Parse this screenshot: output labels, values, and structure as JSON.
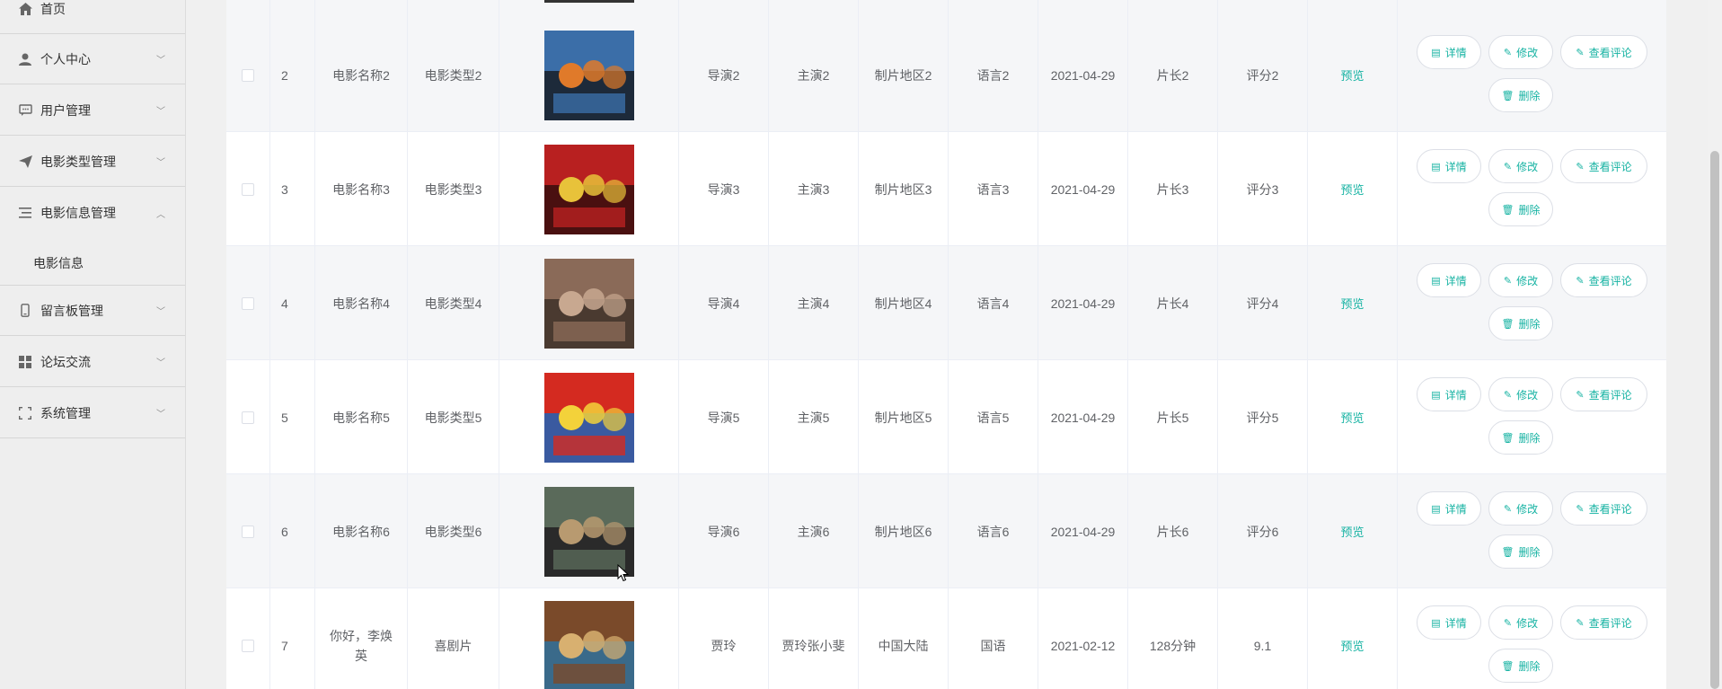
{
  "sidebar": {
    "items": [
      {
        "label": "首页",
        "icon": "home-icon"
      },
      {
        "label": "个人中心",
        "icon": "user-icon"
      },
      {
        "label": "用户管理",
        "icon": "chat-icon"
      },
      {
        "label": "电影类型管理",
        "icon": "send-icon"
      },
      {
        "label": "电影信息管理",
        "icon": "list-icon"
      },
      {
        "label": "留言板管理",
        "icon": "phone-icon"
      },
      {
        "label": "论坛交流",
        "icon": "grid-icon"
      },
      {
        "label": "系统管理",
        "icon": "fullscreen-icon"
      }
    ],
    "submenu": {
      "label": "电影信息"
    }
  },
  "table": {
    "rows": [
      {
        "id": "2",
        "name": "电影名称2",
        "type": "电影类型2",
        "director": "导演2",
        "actor": "主演2",
        "region": "制片地区2",
        "language": "语言2",
        "date": "2021-04-29",
        "duration": "片长2",
        "rating": "评分2",
        "preview": "预览"
      },
      {
        "id": "3",
        "name": "电影名称3",
        "type": "电影类型3",
        "director": "导演3",
        "actor": "主演3",
        "region": "制片地区3",
        "language": "语言3",
        "date": "2021-04-29",
        "duration": "片长3",
        "rating": "评分3",
        "preview": "预览"
      },
      {
        "id": "4",
        "name": "电影名称4",
        "type": "电影类型4",
        "director": "导演4",
        "actor": "主演4",
        "region": "制片地区4",
        "language": "语言4",
        "date": "2021-04-29",
        "duration": "片长4",
        "rating": "评分4",
        "preview": "预览"
      },
      {
        "id": "5",
        "name": "电影名称5",
        "type": "电影类型5",
        "director": "导演5",
        "actor": "主演5",
        "region": "制片地区5",
        "language": "语言5",
        "date": "2021-04-29",
        "duration": "片长5",
        "rating": "评分5",
        "preview": "预览"
      },
      {
        "id": "6",
        "name": "电影名称6",
        "type": "电影类型6",
        "director": "导演6",
        "actor": "主演6",
        "region": "制片地区6",
        "language": "语言6",
        "date": "2021-04-29",
        "duration": "片长6",
        "rating": "评分6",
        "preview": "预览"
      },
      {
        "id": "7",
        "name": "你好，李焕英",
        "type": "喜剧片",
        "director": "贾玲",
        "actor": "贾玲张小斐",
        "region": "中国大陆",
        "language": "国语",
        "date": "2021-02-12",
        "duration": "128分钟",
        "rating": "9.1",
        "preview": "预览"
      }
    ],
    "actions": {
      "detail": "详情",
      "edit": "修改",
      "comments": "查看评论",
      "delete": "删除"
    }
  },
  "colors": {
    "accent": "#17b3a3",
    "sidebar_bg": "#eeeeee",
    "row_alt": "#f5f6f8"
  }
}
